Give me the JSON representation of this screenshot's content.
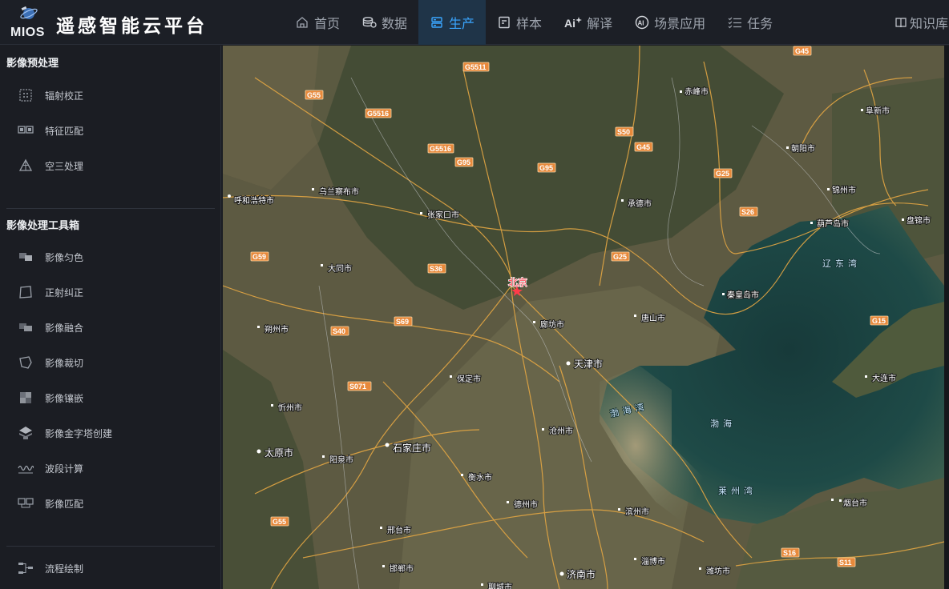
{
  "app": {
    "logo_text": "MIOS",
    "title": "遥感智能云平台"
  },
  "nav": [
    {
      "label": "首页",
      "icon": "home-icon"
    },
    {
      "label": "数据",
      "icon": "database-icon"
    },
    {
      "label": "生产",
      "icon": "server-icon",
      "active": true
    },
    {
      "label": "样本",
      "icon": "sample-icon"
    },
    {
      "label": "解译",
      "icon": "ai-sparkle-icon"
    },
    {
      "label": "场景应用",
      "icon": "ai-badge-icon"
    },
    {
      "label": "任务",
      "icon": "task-list-icon"
    },
    {
      "label": "知识库",
      "icon": "book-icon"
    }
  ],
  "sidebar": {
    "section1": {
      "title": "影像预处理",
      "items": [
        {
          "label": "辐射校正",
          "icon": "radiometric-icon"
        },
        {
          "label": "特征匹配",
          "icon": "feature-match-icon"
        },
        {
          "label": "空三处理",
          "icon": "triangulation-icon"
        }
      ]
    },
    "section2": {
      "title": "影像处理工具箱",
      "items": [
        {
          "label": "影像匀色",
          "icon": "color-balance-icon"
        },
        {
          "label": "正射纠正",
          "icon": "ortho-icon"
        },
        {
          "label": "影像融合",
          "icon": "fusion-icon"
        },
        {
          "label": "影像裁切",
          "icon": "clip-icon"
        },
        {
          "label": "影像镶嵌",
          "icon": "mosaic-icon"
        },
        {
          "label": "影像金字塔创建",
          "icon": "pyramid-icon"
        },
        {
          "label": "波段计算",
          "icon": "wave-icon"
        },
        {
          "label": "影像匹配",
          "icon": "image-match-icon"
        }
      ]
    },
    "footer": {
      "label": "流程绘制",
      "icon": "flow-icon"
    }
  },
  "map": {
    "cities": [
      "赤峰市",
      "阜新市",
      "朝阳市",
      "锦州市",
      "盘锦市",
      "葫芦岛市",
      "承德市",
      "秦皇岛市",
      "呼和浩特市",
      "乌兰察布市",
      "张家口市",
      "大同市",
      "北京",
      "廊坊市",
      "唐山市",
      "天津市",
      "朔州市",
      "保定市",
      "忻州市",
      "沧州市",
      "石家庄市",
      "太原市",
      "阳泉市",
      "衡水市",
      "德州市",
      "滨州市",
      "东营市",
      "邢台市",
      "淄博市",
      "邯郸市",
      "济南市",
      "潍坊市",
      "烟台市",
      "大连市",
      "聊城市"
    ],
    "seas": [
      "辽东湾",
      "渤海湾",
      "渤海",
      "莱州湾"
    ],
    "highways": [
      "G45",
      "G5511",
      "G55",
      "G5516",
      "G5516",
      "G95",
      "S50",
      "G45",
      "G95",
      "G25",
      "S26",
      "G25",
      "G59",
      "S36",
      "S40",
      "S69",
      "G15",
      "S071",
      "G55",
      "S16",
      "S11"
    ],
    "colors": {
      "sea": "#1e4a47",
      "land": "#5a5a3f",
      "road": "#e3a643",
      "accent": "#3aa6ff"
    }
  }
}
